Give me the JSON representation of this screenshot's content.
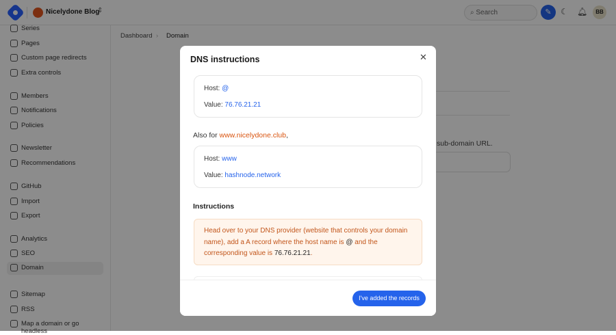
{
  "header": {
    "blog_name": "Nicelydone Blog",
    "search_placeholder": "Search",
    "avatar_initials": "BB"
  },
  "sidebar": {
    "items": [
      {
        "label": "Series"
      },
      {
        "label": "Pages"
      },
      {
        "label": "Custom page redirects"
      },
      {
        "label": "Extra controls"
      },
      {
        "label": "Members"
      },
      {
        "label": "Notifications"
      },
      {
        "label": "Policies"
      },
      {
        "label": "Newsletter"
      },
      {
        "label": "Recommendations"
      },
      {
        "label": "GitHub"
      },
      {
        "label": "Import"
      },
      {
        "label": "Export"
      },
      {
        "label": "Analytics"
      },
      {
        "label": "SEO"
      },
      {
        "label": "Domain",
        "active": true
      },
      {
        "label": "Sitemap"
      },
      {
        "label": "RSS"
      },
      {
        "label": "Map a domain or go headless"
      }
    ]
  },
  "breadcrumb": {
    "parent": "Dashboard",
    "current": "Domain"
  },
  "background": {
    "subdomain_text": "sub-domain URL."
  },
  "modal": {
    "title": "DNS instructions",
    "record1": {
      "host_label": "Host:",
      "host": "@",
      "value_label": "Value:",
      "value": "76.76.21.21"
    },
    "also_prefix": "Also for ",
    "also_domain": "www.nicelydone.club",
    "also_suffix": ",",
    "record2": {
      "host_label": "Host:",
      "host": "www",
      "value_label": "Value:",
      "value": "hashnode.network"
    },
    "instructions_heading": "Instructions",
    "instr_1": "Head over to your DNS provider (website that controls your domain name), add a A record where the host name is ",
    "instr_host": "@",
    "instr_2": " and the corresponding value is ",
    "instr_value": "76.76.21.21",
    "instr_3": ".",
    "confirm_button": "I've added the records"
  },
  "colors": {
    "accent": "#2563eb",
    "warning_text": "#c2551a",
    "warning_bg": "#fff5ec"
  }
}
